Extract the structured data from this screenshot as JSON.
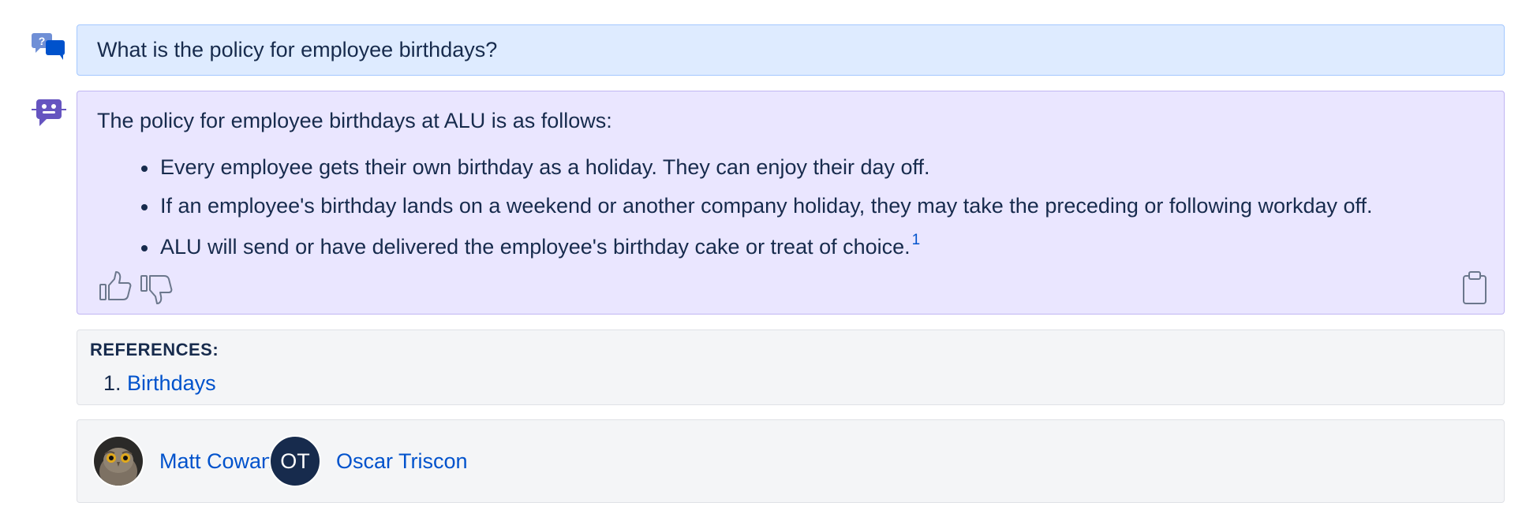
{
  "question": {
    "icon": "chat-question-icon",
    "text": "What is the policy for employee birthdays?"
  },
  "answer": {
    "icon": "robot-icon",
    "intro": "The policy for employee birthdays at ALU is as follows:",
    "bullets": [
      "Every employee gets their own birthday as a holiday. They can enjoy their day off.",
      "If an employee's birthday lands on a weekend or another company holiday, they may take the preceding or following workday off.",
      "ALU will send or have delivered the employee's birthday cake or treat of choice."
    ],
    "citation": "1",
    "actions": {
      "like_icon": "thumbs-up-icon",
      "dislike_icon": "thumbs-down-icon",
      "copy_icon": "clipboard-icon"
    }
  },
  "references": {
    "title": "REFERENCES:",
    "items": [
      {
        "number": "1.",
        "label": "Birthdays"
      }
    ]
  },
  "people": [
    {
      "name": "Matt Cowan",
      "avatar": "photo"
    },
    {
      "name": "Oscar Triscon",
      "initials": "OT"
    }
  ],
  "colors": {
    "question_bg": "#deebff",
    "answer_bg": "#eae6ff",
    "link": "#0052cc",
    "text": "#172b4d",
    "panel_bg": "#f4f5f7"
  }
}
